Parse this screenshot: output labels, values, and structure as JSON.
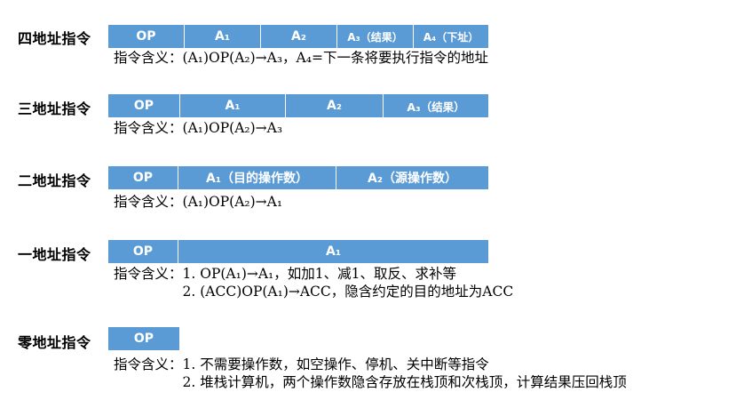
{
  "sections": [
    {
      "title": "四地址指令",
      "fields": [
        "OP",
        "A₁",
        "A₂",
        "A₃（结果）",
        "A₄（下址）"
      ],
      "desc_label": "指令含义：",
      "lines": [
        "(A₁)OP(A₂)→A₃，A₄=下一条将要执行指令的地址"
      ]
    },
    {
      "title": "三地址指令",
      "fields": [
        "OP",
        "A₁",
        "A₂",
        "A₃（结果）"
      ],
      "desc_label": "指令含义：",
      "lines": [
        "(A₁)OP(A₂)→A₃"
      ]
    },
    {
      "title": "二地址指令",
      "fields": [
        "OP",
        "A₁（目的操作数）",
        "A₂（源操作数）"
      ],
      "desc_label": "指令含义：",
      "lines": [
        "(A₁)OP(A₂)→A₁"
      ]
    },
    {
      "title": "一地址指令",
      "fields": [
        "OP",
        "A₁"
      ],
      "desc_label": "指令含义：",
      "lines": [
        "1. OP(A₁)→A₁，如加1、减1、取反、求补等",
        "2. (ACC)OP(A₁)→ACC，隐含约定的目的地址为ACC"
      ]
    },
    {
      "title": "零地址指令",
      "fields": [
        "OP"
      ],
      "desc_label": "指令含义：",
      "lines": [
        "1. 不需要操作数，如空操作、停机、关中断等指令",
        "2. 堆栈计算机，两个操作数隐含存放在栈顶和次栈顶，计算结果压回栈顶"
      ]
    }
  ],
  "colors": {
    "field_fill": "#5b9bd5",
    "field_text": "#ffffff"
  }
}
